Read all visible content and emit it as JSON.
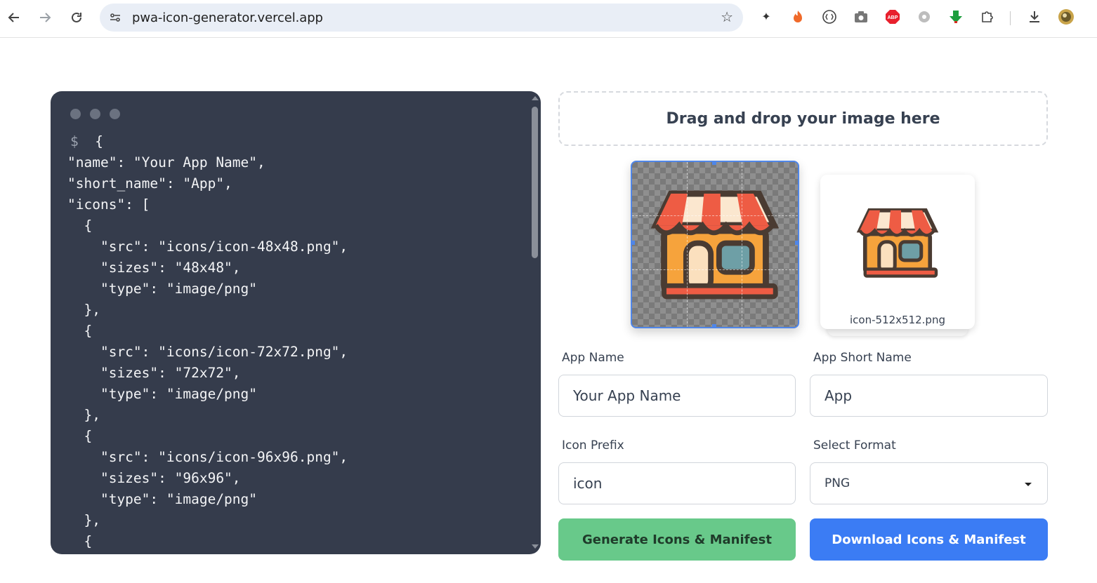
{
  "browser": {
    "url": "pwa-icon-generator.vercel.app",
    "back_icon": "arrow-left-icon",
    "forward_icon": "arrow-right-icon",
    "reload_icon": "reload-icon",
    "extensions": [
      "magic-wand-icon",
      "fire-icon",
      "circle-brackets-icon",
      "camera-icon",
      "adblock-icon",
      "gear-flower-icon",
      "download-arrow-green-icon",
      "puzzle-icon"
    ],
    "downloads_icon": "download-icon",
    "profile_icon": "avatar"
  },
  "code_panel": {
    "prompt": "$",
    "lines": [
      " {",
      "\"name\": \"Your App Name\",",
      "\"short_name\": \"App\",",
      "\"icons\": [",
      "  {",
      "    \"src\": \"icons/icon-48x48.png\",",
      "    \"sizes\": \"48x48\",",
      "    \"type\": \"image/png\"",
      "  },",
      "  {",
      "    \"src\": \"icons/icon-72x72.png\",",
      "    \"sizes\": \"72x72\",",
      "    \"type\": \"image/png\"",
      "  },",
      "  {",
      "    \"src\": \"icons/icon-96x96.png\",",
      "    \"sizes\": \"96x96\",",
      "    \"type\": \"image/png\"",
      "  },",
      "  {"
    ]
  },
  "dropzone": {
    "label": "Drag and drop your image here"
  },
  "preview": {
    "caption": "icon-512x512.png"
  },
  "form": {
    "app_name": {
      "label": "App Name",
      "value": "Your App Name"
    },
    "short_name": {
      "label": "App Short Name",
      "value": "App"
    },
    "icon_prefix": {
      "label": "Icon Prefix",
      "value": "icon"
    },
    "format": {
      "label": "Select Format",
      "value": "PNG"
    }
  },
  "buttons": {
    "generate": "Generate Icons & Manifest",
    "download": "Download Icons & Manifest"
  },
  "colors": {
    "code_bg": "#353c4c",
    "generate_bg": "#68c98a",
    "download_bg": "#3b7cf4"
  }
}
